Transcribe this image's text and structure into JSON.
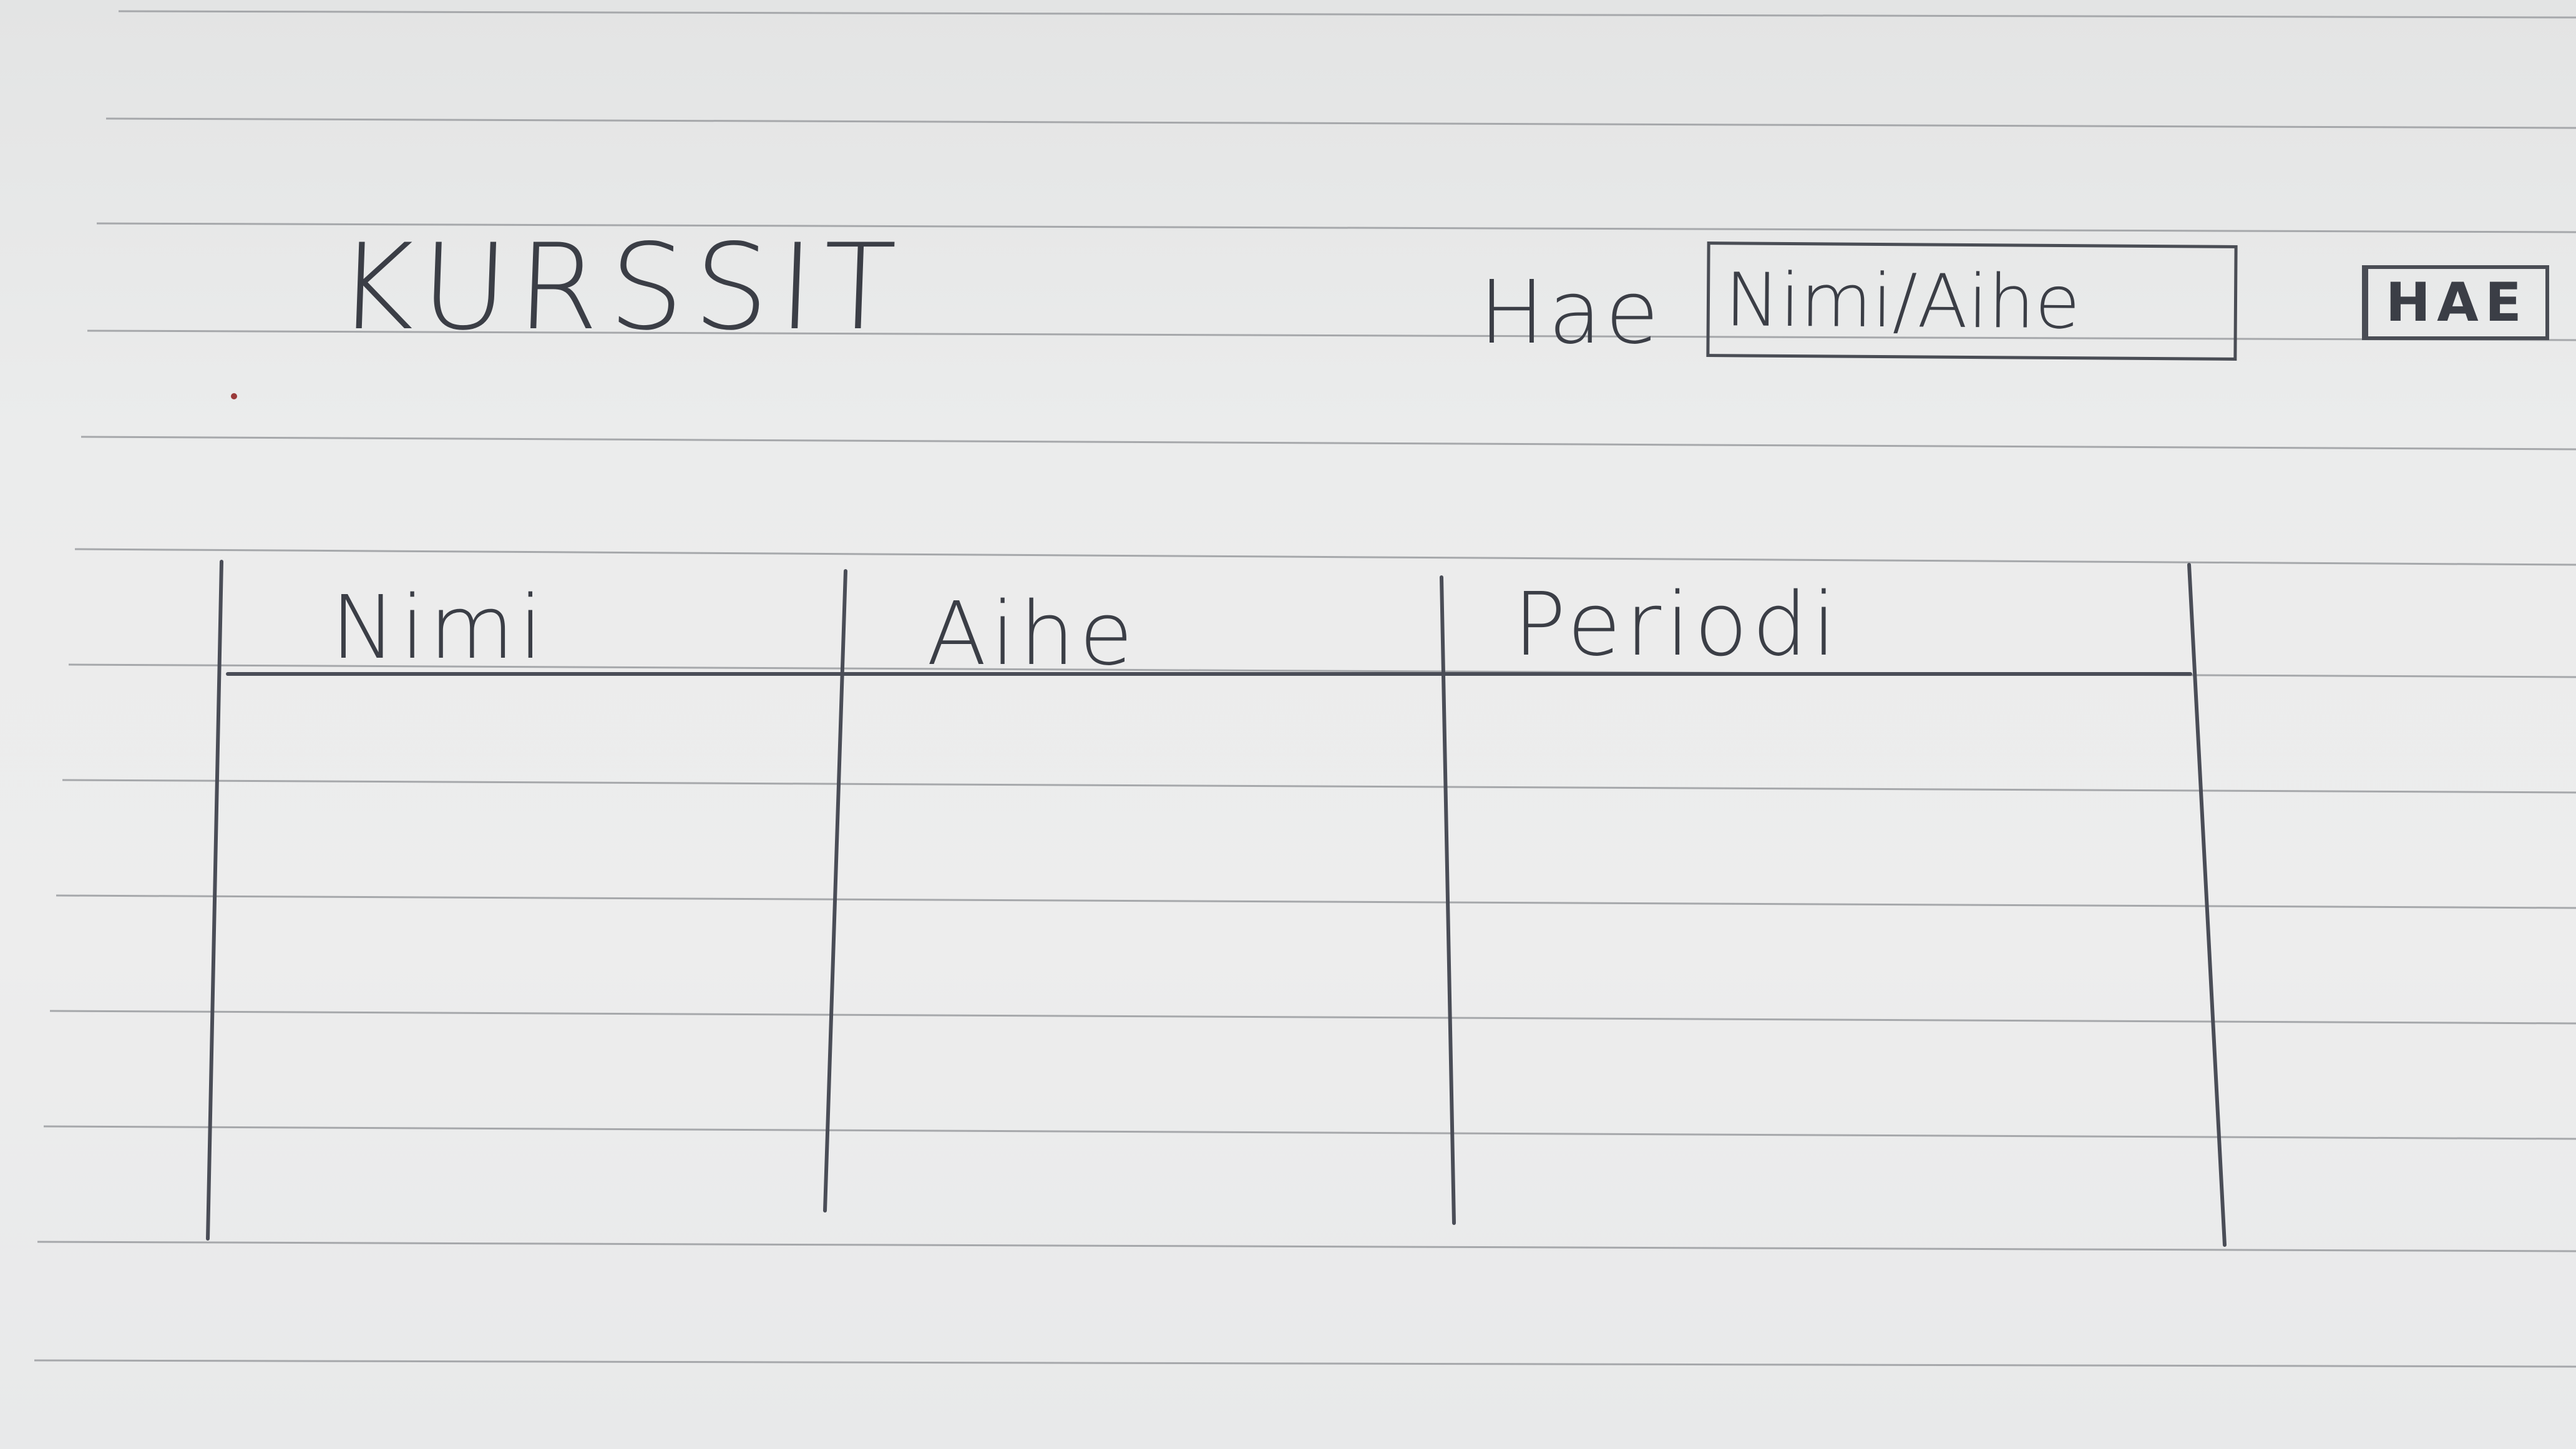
{
  "header": {
    "title": "KURSSIT",
    "search_label": "Hae",
    "search_placeholder": "Nimi/Aihe",
    "search_value": "",
    "search_button_label": "HAE"
  },
  "table": {
    "columns": [
      "Nimi",
      "Aihe",
      "Periodi"
    ],
    "rows": [
      [
        "",
        "",
        ""
      ],
      [
        "",
        "",
        ""
      ],
      [
        "",
        "",
        ""
      ],
      [
        "",
        "",
        ""
      ],
      [
        "",
        "",
        ""
      ]
    ]
  },
  "colors": {
    "paper": "#ebecec",
    "ruled_line": "#a6a8ab",
    "pencil": "#3b3e46"
  }
}
